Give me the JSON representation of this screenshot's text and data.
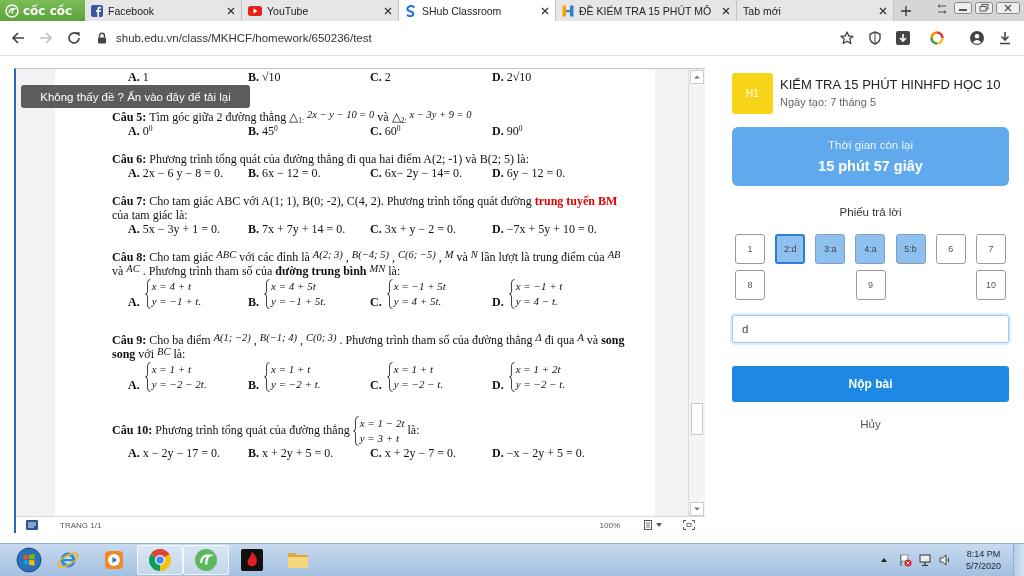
{
  "browser": {
    "logo": "cốc cốc",
    "tabs": [
      {
        "title": "Facebook",
        "kind": "facebook",
        "selected": false
      },
      {
        "title": "YouTube",
        "kind": "youtube",
        "selected": false
      },
      {
        "title": "SHub Classroom",
        "kind": "shub",
        "selected": true
      },
      {
        "title": "ĐỀ KIỂM TRA 15 PHÚT MÔ",
        "kind": "document",
        "selected": false
      },
      {
        "title": "Tab mới",
        "kind": "blank",
        "selected": false
      }
    ],
    "forward_disabled": true,
    "url": "shub.edu.vn/class/MKHCF/homework/650236/test"
  },
  "document": {
    "lead_options": [
      {
        "letter": "A.",
        "kind": "text",
        "text": "1"
      },
      {
        "letter": "B.",
        "kind": "text",
        "text": "√10"
      },
      {
        "letter": "C.",
        "kind": "text",
        "text": "2"
      },
      {
        "letter": "D.",
        "kind": "text",
        "text": "2√10"
      }
    ],
    "questions": [
      {
        "stem": [
          {
            "kind": "text",
            "text": "**Câu 5:** Tìm góc giữa 2 đường thẳng △$_{1:}$"
          },
          {
            "kind": "math",
            "text": "2x − y − 10 = 0"
          },
          {
            "kind": "text",
            "text": "và △$_{2:}$"
          },
          {
            "kind": "math",
            "text": "x − 3y + 9 = 0"
          }
        ],
        "options": [
          {
            "letter": "A.",
            "kind": "text",
            "text": "0$^{0}$"
          },
          {
            "letter": "B.",
            "kind": "text",
            "text": "45$^{0}$"
          },
          {
            "letter": "C.",
            "kind": "text",
            "text": "60$^{0}$"
          },
          {
            "letter": "D.",
            "kind": "text",
            "text": "90$^{0}$"
          }
        ]
      },
      {
        "stem": [
          {
            "kind": "text",
            "text": "**Câu 6:** Phương trình tổng quát của đường thẳng đi qua hai điểm A(2; -1) và B(2; 5) là:"
          }
        ],
        "options": [
          {
            "letter": "A.",
            "kind": "text",
            "text": "2x − 6 y − 8 = 0."
          },
          {
            "letter": "B.",
            "kind": "text",
            "text": "6x − 12 = 0."
          },
          {
            "letter": "C.",
            "kind": "text",
            "text": "6x− 2y − 14= 0."
          },
          {
            "letter": "D.",
            "kind": "text",
            "text": "6y − 12 = 0."
          }
        ]
      },
      {
        "stem": [
          {
            "kind": "text",
            "text": "**Câu 7:** Cho tam giác ABC với A(1; 1), B(0; -2), C(4, 2). Phương trình tổng quát đường"
          },
          {
            "kind": "highlight",
            "text": "trung tuyến BM"
          },
          {
            "kind": "text",
            "text": "của tam giác là:"
          }
        ],
        "options": [
          {
            "letter": "A.",
            "kind": "text",
            "text": "5x − 3y + 1 = 0."
          },
          {
            "letter": "B.",
            "kind": "text",
            "text": "7x + 7y + 14 = 0."
          },
          {
            "letter": "C.",
            "kind": "text",
            "text": "3x + y − 2 = 0."
          },
          {
            "letter": "D.",
            "kind": "text",
            "text": "−7x + 5y + 10  = 0."
          }
        ]
      },
      {
        "stem": [
          {
            "kind": "text",
            "text": "**Câu 8:** Cho tam giác"
          },
          {
            "kind": "math",
            "text": "ABC"
          },
          {
            "kind": "text",
            "text": "với các đỉnh là"
          },
          {
            "kind": "math",
            "text": "A(2; 3)"
          },
          {
            "kind": "text",
            "text": ","
          },
          {
            "kind": "math",
            "text": "B(−4; 5)"
          },
          {
            "kind": "text",
            "text": ","
          },
          {
            "kind": "math",
            "text": "C(6; −5)"
          },
          {
            "kind": "text",
            "text": ","
          },
          {
            "kind": "math",
            "text": "M"
          },
          {
            "kind": "text",
            "text": "và"
          },
          {
            "kind": "math",
            "text": "N"
          },
          {
            "kind": "text",
            "text": "lần lượt là trung điểm của"
          },
          {
            "kind": "math",
            "text": "AB"
          },
          {
            "kind": "text",
            "text": "và"
          },
          {
            "kind": "math",
            "text": "AC"
          },
          {
            "kind": "text",
            "text": ". Phương trình tham số của **đường trung bình**"
          },
          {
            "kind": "math",
            "text": "MN"
          },
          {
            "kind": "text",
            "text": "là:"
          }
        ],
        "options": [
          {
            "letter": "A.",
            "kind": "system",
            "lines": [
              "x = 4 + t",
              "y = −1 + t."
            ]
          },
          {
            "letter": "B.",
            "kind": "system",
            "lines": [
              "x = 4 + 5t",
              "y = −1 + 5t."
            ]
          },
          {
            "letter": "C.",
            "kind": "system",
            "lines": [
              "x = −1 + 5t",
              "y = 4 + 5t."
            ]
          },
          {
            "letter": "D.",
            "kind": "system",
            "lines": [
              "x = −1 + t",
              "y = 4 − t."
            ]
          }
        ]
      },
      {
        "stem": [
          {
            "kind": "text",
            "text": "**Câu 9:** Cho ba điểm"
          },
          {
            "kind": "math",
            "text": "A(1; −2)"
          },
          {
            "kind": "text",
            "text": ","
          },
          {
            "kind": "math",
            "text": "B(−1; 4)"
          },
          {
            "kind": "text",
            "text": ","
          },
          {
            "kind": "math",
            "text": "C(0; 3)"
          },
          {
            "kind": "text",
            "text": ". Phương trình tham số của đường thẳng"
          },
          {
            "kind": "math",
            "text": "Δ"
          },
          {
            "kind": "text",
            "text": "đi qua"
          },
          {
            "kind": "math",
            "text": "A"
          },
          {
            "kind": "text",
            "text": "và **song song** với"
          },
          {
            "kind": "math",
            "text": "BC"
          },
          {
            "kind": "text",
            "text": "là:"
          }
        ],
        "options": [
          {
            "letter": "A.",
            "kind": "system",
            "lines": [
              "x = 1 + t",
              "y = −2 − 2t."
            ]
          },
          {
            "letter": "B.",
            "kind": "system",
            "lines": [
              "x = 1 + t",
              "y = −2 + t."
            ]
          },
          {
            "letter": "C.",
            "kind": "system",
            "lines": [
              "x = 1 + t",
              "y = −2 − t."
            ]
          },
          {
            "letter": "D.",
            "kind": "system",
            "lines": [
              "x = 1 + 2t",
              "y = −2 − t."
            ]
          }
        ]
      },
      {
        "stem": [
          {
            "kind": "text",
            "text": "**Câu 10:** Phương trình tổng quát của đường thẳng"
          },
          {
            "kind": "system",
            "lines": [
              "x = 1 − 2t",
              "y = 3 + t"
            ]
          },
          {
            "kind": "text",
            "text": "là:"
          }
        ],
        "options": [
          {
            "letter": "A.",
            "kind": "text",
            "text": "x − 2y − 17 = 0."
          },
          {
            "letter": "B.",
            "kind": "text",
            "text": "x + 2y + 5 = 0."
          },
          {
            "letter": "C.",
            "kind": "text",
            "text": "x + 2y − 7 = 0."
          },
          {
            "letter": "D.",
            "kind": "text",
            "text": "−x − 2y + 5 = 0."
          }
        ]
      }
    ],
    "status_bar": {
      "page": "TRANG 1/1",
      "zoom": "100%"
    }
  },
  "reload_notice": "Không thấy đề ? Ấn vào đây để tải lại",
  "assignment": {
    "badge": "H1",
    "title": "KIẾM TRA 15 PHÚT HINHFD HỌC 10",
    "created": "Ngày tạo: 7 tháng 5"
  },
  "timer": {
    "label": "Thời gian còn lại",
    "value": "15 phút 57 giây"
  },
  "answer_sheet": {
    "title": "Phiếu trả lời",
    "cells": [
      {
        "label": "1",
        "answered": false,
        "selected": false
      },
      {
        "label": "2:d",
        "answered": true,
        "selected": true
      },
      {
        "label": "3:a",
        "answered": true,
        "selected": false
      },
      {
        "label": "4:a",
        "answered": true,
        "selected": false
      },
      {
        "label": "5:b",
        "answered": true,
        "selected": false
      },
      {
        "label": "6",
        "answered": false,
        "selected": false
      },
      {
        "label": "7",
        "answered": false,
        "selected": false
      },
      {
        "label": "8",
        "answered": false,
        "selected": false
      },
      {
        "label": "9",
        "answered": false,
        "selected": false
      },
      {
        "label": "10",
        "answered": false,
        "selected": false
      }
    ],
    "input": {
      "value": "d"
    }
  },
  "actions": {
    "submit": "Nộp bài",
    "cancel": "Hủy"
  },
  "taskbar": {
    "apps": [
      {
        "kind": "ie",
        "running": false
      },
      {
        "kind": "media",
        "running": false
      },
      {
        "kind": "chrome",
        "running": true
      },
      {
        "kind": "coccoc",
        "running": true
      },
      {
        "kind": "garena",
        "running": false
      },
      {
        "kind": "folder",
        "running": false
      }
    ],
    "time": "8:14 PM",
    "date": "5/7/2020"
  }
}
